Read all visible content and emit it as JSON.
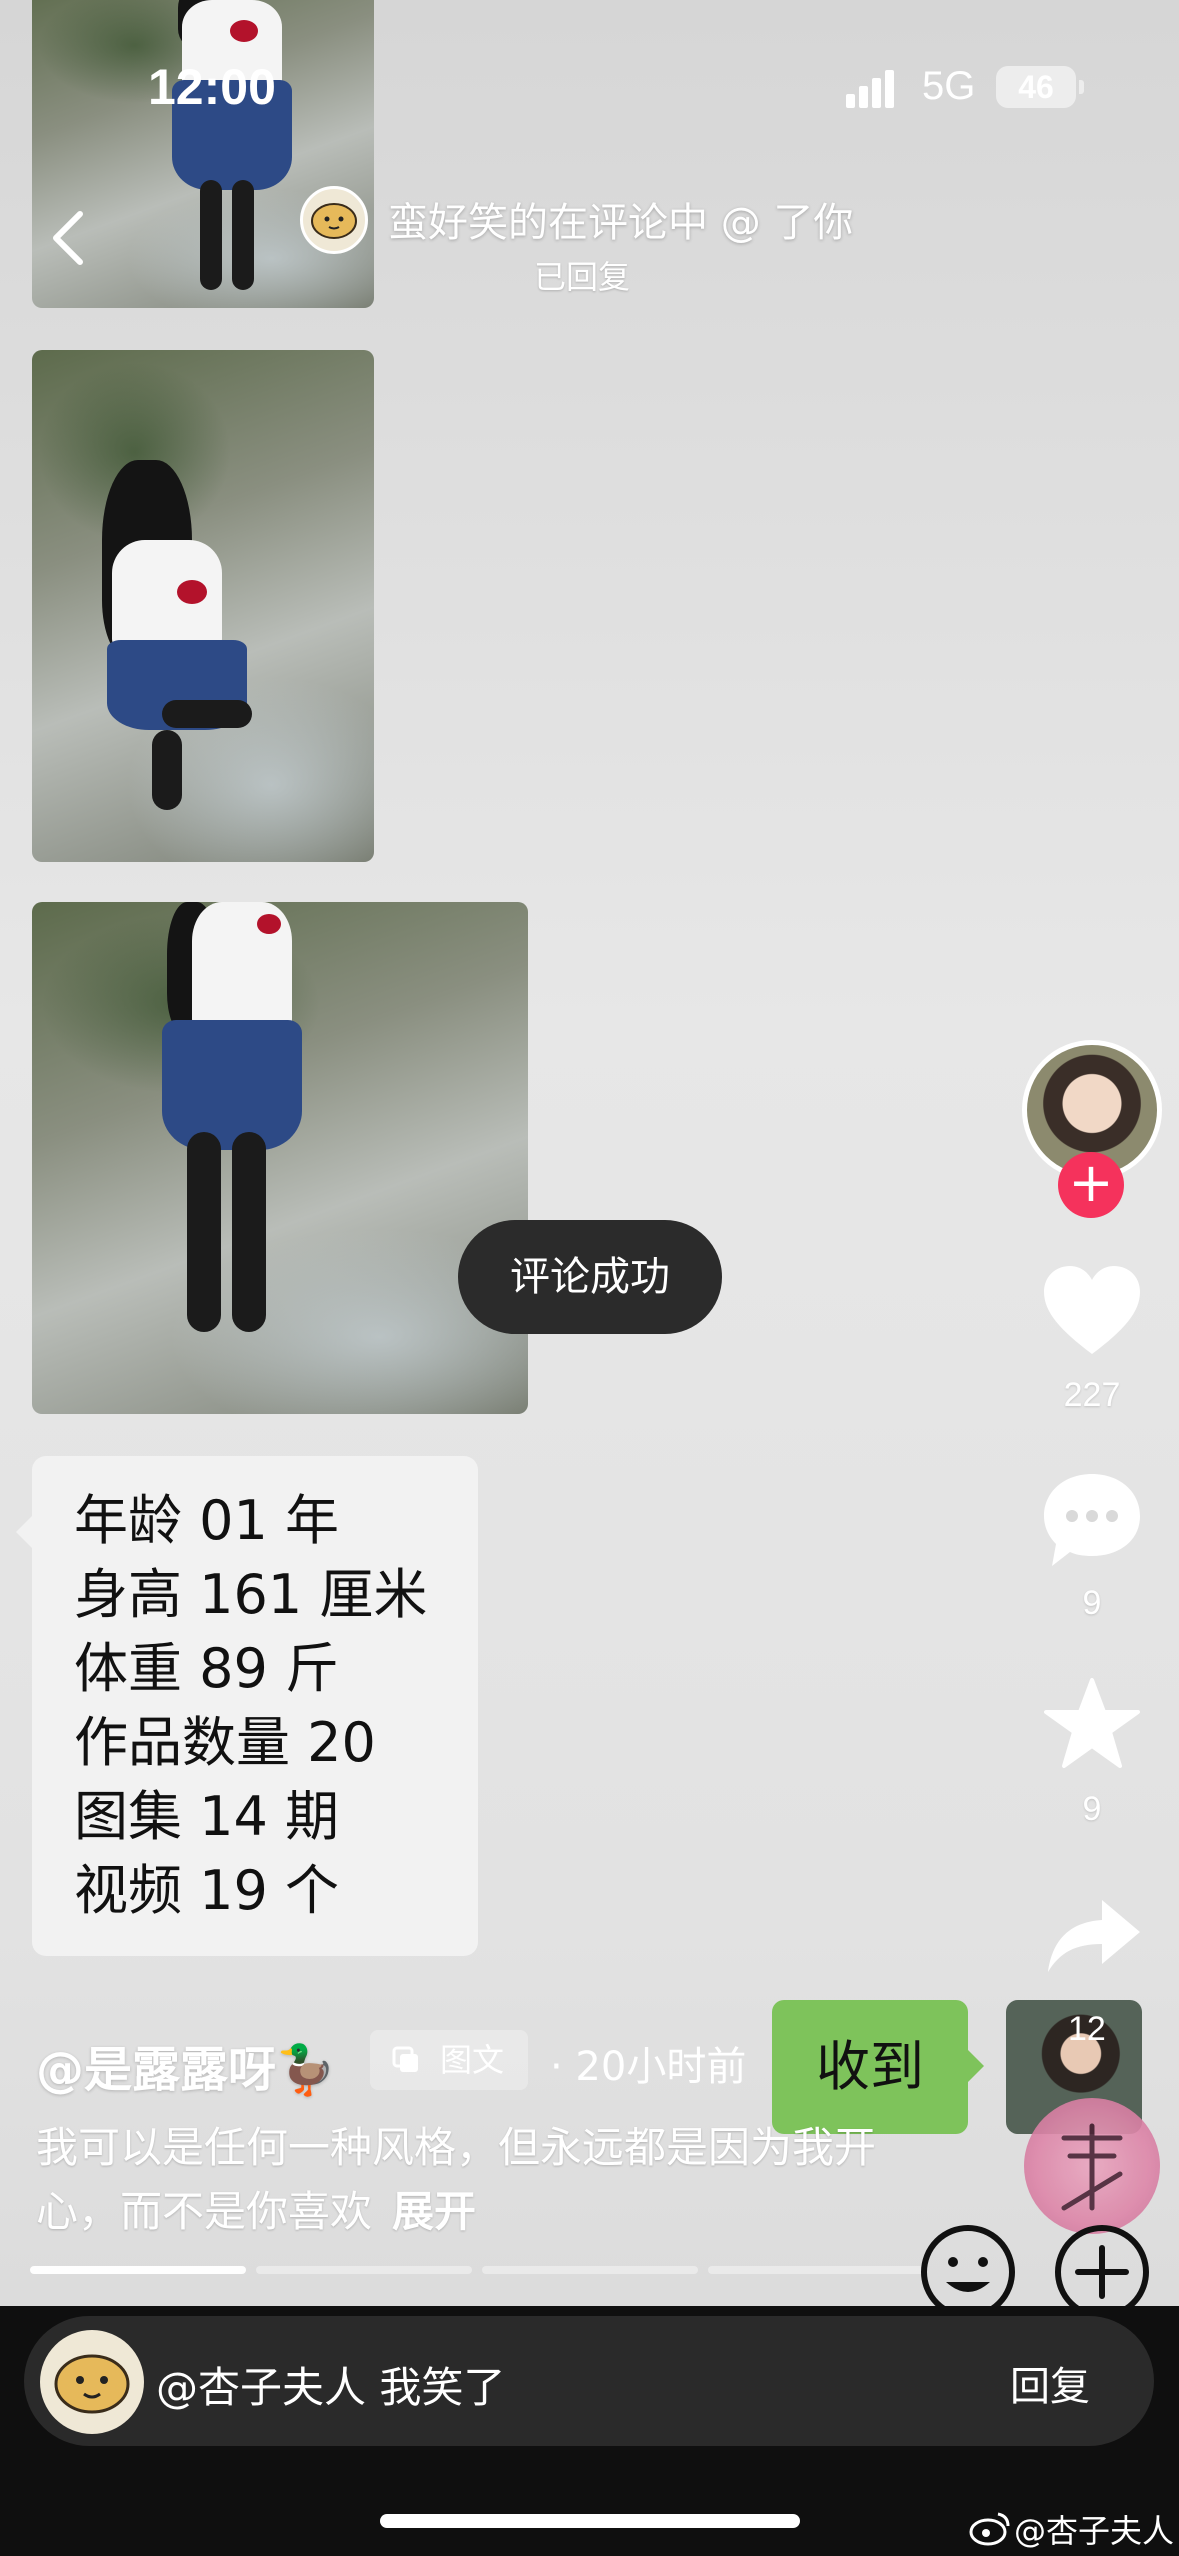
{
  "status_bar": {
    "time": "12:00",
    "network": "5G",
    "battery": "46"
  },
  "header": {
    "title": "蛮好笑的在评论中 @ 了你",
    "subtitle": "已回复"
  },
  "info_card": {
    "lines": [
      "年龄 01 年",
      "身高 161 厘米",
      "体重 89 斤",
      "作品数量 20",
      "图集 14 期",
      "视频 19 个"
    ]
  },
  "toast": {
    "text": "评论成功"
  },
  "actions": {
    "likes": "227",
    "comments": "9",
    "favorites": "9"
  },
  "received_bubble": {
    "text": "收到"
  },
  "thumb_badge": "12",
  "post": {
    "author": "@是露露呀🦆",
    "type_label": "图文",
    "time": "· 20小时前",
    "caption": "我可以是任何一种风格，但永远都是因为我开心，而不是你喜欢",
    "expand_label": "展开"
  },
  "reply_bar": {
    "text": "@杏子夫人 我笑了",
    "reply_label": "回复"
  },
  "watermark": "@杏子夫人",
  "colors": {
    "follow": "#f5325c",
    "bubble_green": "#7ec35b",
    "toast_bg": "#2b2b2b"
  }
}
